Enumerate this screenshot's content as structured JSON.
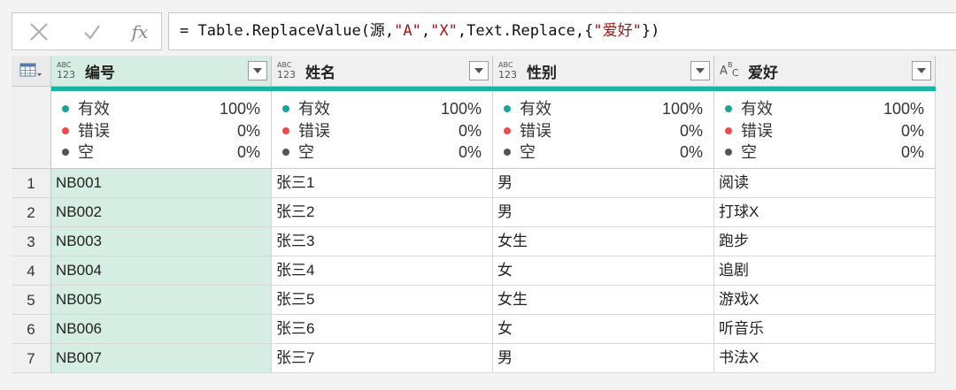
{
  "formula_bar": {
    "cancel_icon": "close-x-icon",
    "confirm_icon": "check-icon",
    "fx_label": "fx",
    "prefix": "= Table.ReplaceValue(源,",
    "arg1": "\"A\"",
    "sep1": ",",
    "arg2": "\"X\"",
    "middle": ",Text.Replace,{",
    "arg3": "\"爱好\"",
    "suffix": "})"
  },
  "table": {
    "corner_icon": "table-menu-icon",
    "columns": [
      {
        "name": "编号",
        "type_icon": "abc-123-icon"
      },
      {
        "name": "姓名",
        "type_icon": "abc-123-icon"
      },
      {
        "name": "性别",
        "type_icon": "abc-123-icon"
      },
      {
        "name": "爱好",
        "type_icon": "abc-text-icon"
      }
    ],
    "type_icon_text": {
      "top": "ABC",
      "bottom": "123",
      "text_a": "A",
      "text_b": "B",
      "text_c": "C"
    },
    "quality_color": "#19b3a6",
    "quality": [
      {
        "valid_label": "有效",
        "valid": "100%",
        "error_label": "错误",
        "error": "0%",
        "empty_label": "空",
        "empty": "0%"
      },
      {
        "valid_label": "有效",
        "valid": "100%",
        "error_label": "错误",
        "error": "0%",
        "empty_label": "空",
        "empty": "0%"
      },
      {
        "valid_label": "有效",
        "valid": "100%",
        "error_label": "错误",
        "error": "0%",
        "empty_label": "空",
        "empty": "0%"
      },
      {
        "valid_label": "有效",
        "valid": "100%",
        "error_label": "错误",
        "error": "0%",
        "empty_label": "空",
        "empty": "0%"
      }
    ],
    "dot_colors": {
      "valid": "#1aa39a",
      "error": "#f04a4a",
      "empty": "#555555"
    },
    "rows": [
      {
        "n": "1",
        "cells": [
          "NB001",
          "张三1",
          "男",
          "阅读"
        ]
      },
      {
        "n": "2",
        "cells": [
          "NB002",
          "张三2",
          "男",
          "打球X"
        ]
      },
      {
        "n": "3",
        "cells": [
          "NB003",
          "张三3",
          "女生",
          "跑步"
        ]
      },
      {
        "n": "4",
        "cells": [
          "NB004",
          "张三4",
          "女",
          "追剧"
        ]
      },
      {
        "n": "5",
        "cells": [
          "NB005",
          "张三5",
          "女生",
          "游戏X"
        ]
      },
      {
        "n": "6",
        "cells": [
          "NB006",
          "张三6",
          "女",
          "听音乐"
        ]
      },
      {
        "n": "7",
        "cells": [
          "NB007",
          "张三7",
          "男",
          "书法X"
        ]
      }
    ]
  }
}
